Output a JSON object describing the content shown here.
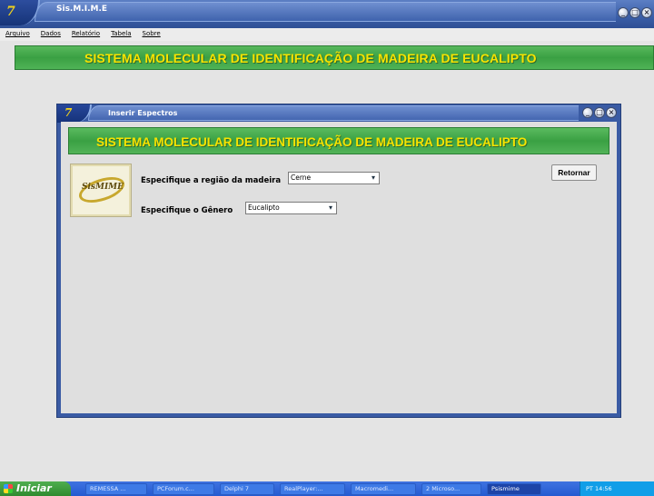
{
  "main_window": {
    "logo": "7",
    "title": "Sis.M.I.M.E",
    "buttons": [
      "_",
      "□",
      "×"
    ]
  },
  "menu": [
    "Arquivo",
    "Dados",
    "Relatório",
    "Tabela",
    "Sobre"
  ],
  "banner": "SISTEMA MOLECULAR DE IDENTIFICAÇÃO DE MADEIRA DE EUCALIPTO",
  "child_window": {
    "logo": "7",
    "title": "Inserir Espectros",
    "buttons": [
      "_",
      "□",
      "×"
    ],
    "banner": "SISTEMA MOLECULAR DE IDENTIFICAÇÃO DE MADEIRA DE EUCALIPTO",
    "sism_logo_text": "SisMIME",
    "region_label": "Especifique a região da madeira",
    "region_value": "Cerne",
    "genus_label": "Especifique o Gênero",
    "genus_value": "Eucalipto",
    "return_button": "Retornar"
  },
  "taskbar": {
    "start": "Iniciar",
    "tasks": [
      "REMESSA ...",
      "PCForum.c...",
      "Delphi 7",
      "RealPlayer:...",
      "Macromedi...",
      "2 Microso...",
      "Psismime"
    ],
    "tray": "PT  14:56"
  },
  "colors": {
    "banner_green": "#3aa043",
    "banner_text": "#f7e300",
    "titlebar_blue": "#3a5ea8"
  }
}
